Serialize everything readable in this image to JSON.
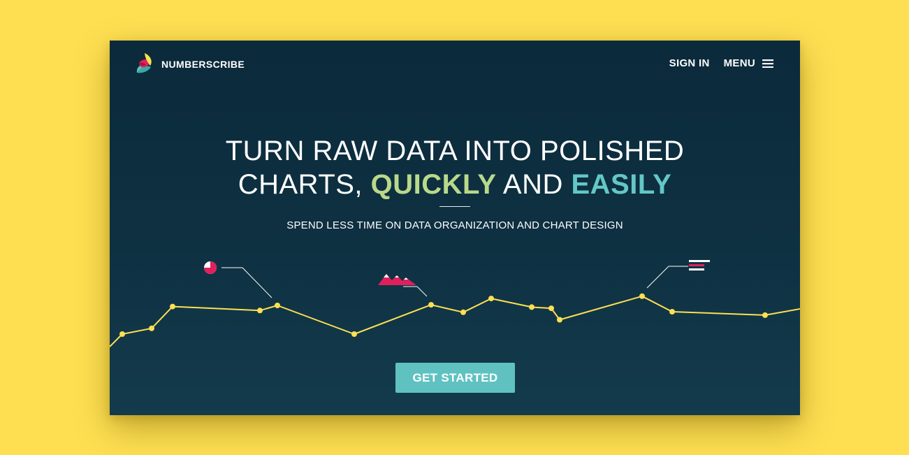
{
  "brand": {
    "name": "NUMBERSCRIBE",
    "logo_icon": "leaf-logo-icon",
    "colors": {
      "yellow": "#fedf52",
      "red": "#e0205c",
      "teal": "#5fc2c1",
      "green": "#b9d98a"
    }
  },
  "nav": {
    "signin_label": "SIGN IN",
    "menu_label": "MENU",
    "menu_icon": "hamburger-icon"
  },
  "hero": {
    "line1": "TURN RAW DATA INTO POLISHED",
    "line2_prefix": "CHARTS,",
    "line2_highlight1": "QUICKLY",
    "line2_middle": "AND",
    "line2_highlight2": "EASILY",
    "subtitle": "SPEND LESS TIME ON DATA ORGANIZATION AND CHART DESIGN"
  },
  "cta": {
    "label": "GET STARTED"
  },
  "chart_data": {
    "type": "line",
    "line_color": "#fedf52",
    "icons": [
      "pie-chart-icon",
      "area-chart-icon",
      "bar-chart-icon"
    ],
    "points": [
      {
        "x": 0,
        "y": 0.0
      },
      {
        "x": 1,
        "y": 0.22
      },
      {
        "x": 2,
        "y": 0.32
      },
      {
        "x": 3,
        "y": 0.7
      },
      {
        "x": 4,
        "y": 0.63
      },
      {
        "x": 5,
        "y": 0.72
      },
      {
        "x": 6,
        "y": 0.22
      },
      {
        "x": 7,
        "y": 0.73
      },
      {
        "x": 8,
        "y": 0.6
      },
      {
        "x": 9,
        "y": 0.84
      },
      {
        "x": 10,
        "y": 0.69
      },
      {
        "x": 11,
        "y": 0.67
      },
      {
        "x": 12,
        "y": 0.47
      },
      {
        "x": 13,
        "y": 0.88
      },
      {
        "x": 14,
        "y": 0.61
      },
      {
        "x": 15,
        "y": 0.55
      },
      {
        "x": 16,
        "y": 0.66
      }
    ]
  }
}
